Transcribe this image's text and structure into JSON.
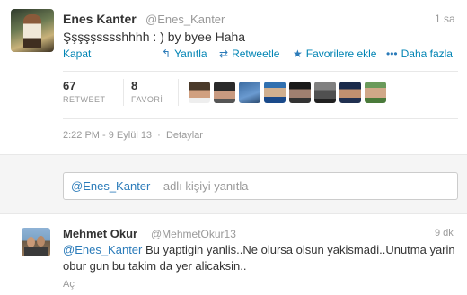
{
  "tweet": {
    "author_name": "Enes Kanter",
    "author_handle": "@Enes_Kanter",
    "time": "1 sa",
    "text": "Şşşşşsssshhhh : ) by byee Haha",
    "collapse_label": "Kapat",
    "actions": {
      "reply": "Yanıtla",
      "retweet": "Retweetle",
      "favorite": "Favorilere ekle",
      "more": "Daha fazla"
    },
    "stats": {
      "retweets": "67",
      "retweets_label": "RETWEET",
      "favorites": "8",
      "favorites_label": "FAVORİ"
    },
    "timestamp": "2:22 PM - 9 Eylül 13",
    "details_link": "Detaylar"
  },
  "reply": {
    "mention": "@Enes_Kanter",
    "placeholder": "adlı kişiyi yanıtla"
  },
  "reply_tweet": {
    "author_name": "Mehmet Okur",
    "author_handle": "@MehmetOkur13",
    "time": "9 dk",
    "mention": "@Enes_Kanter",
    "text": " Bu yaptigin yanlis..Ne olursa olsun yakismadi..Unutma yarin obur gun bu takim da yer alicaksin..",
    "expand_label": "Aç"
  },
  "colors": {
    "link": "#0084b4",
    "mention": "#2b7bb9",
    "muted": "#999999",
    "reply_bg": "#f5f5f5"
  }
}
